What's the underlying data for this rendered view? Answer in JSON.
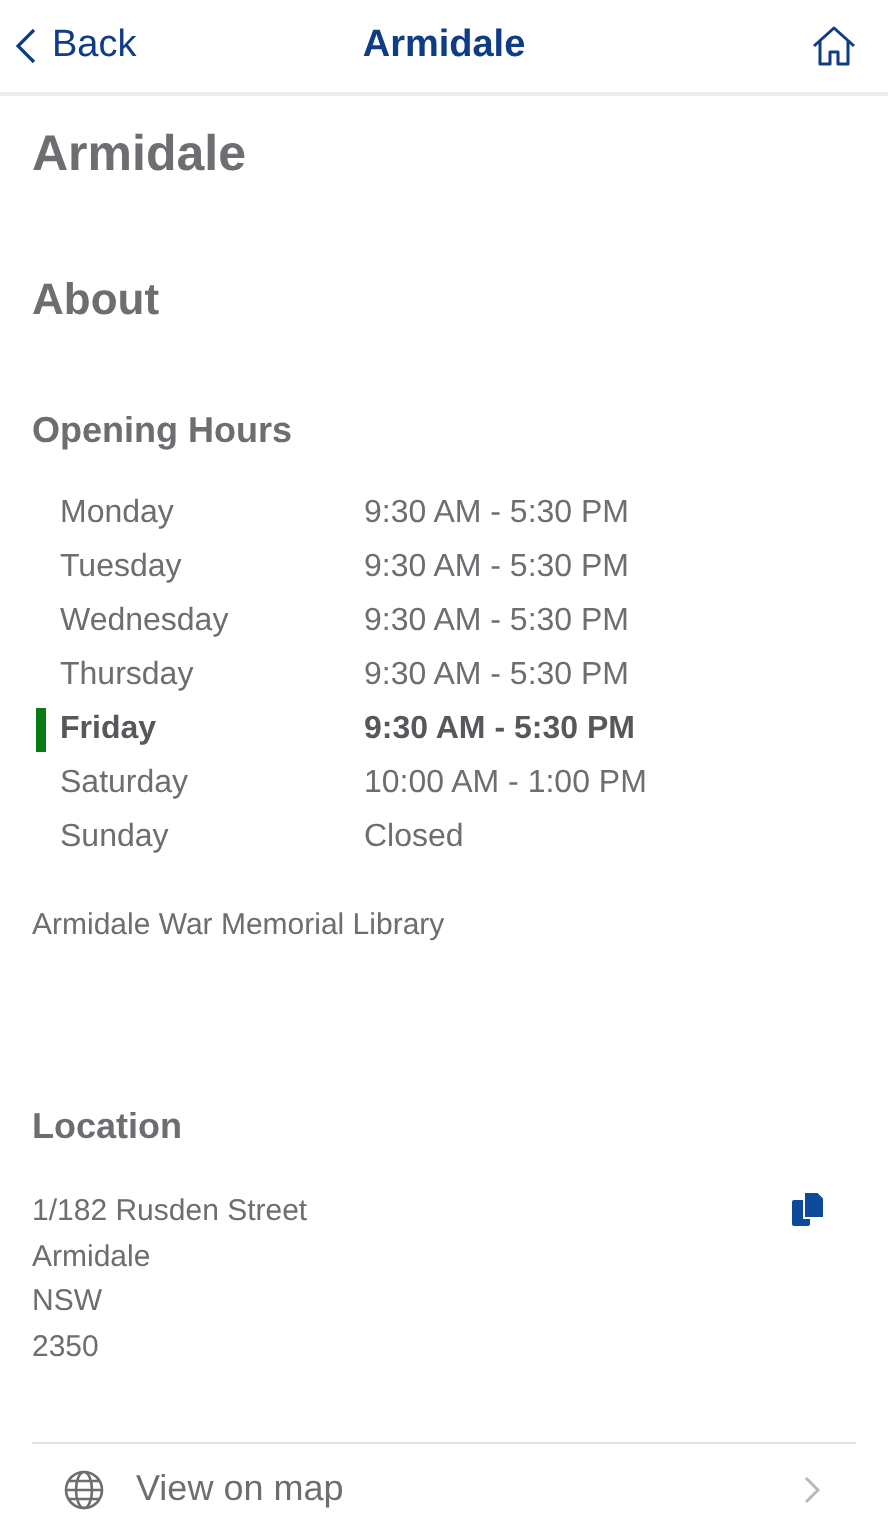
{
  "nav_bar": {
    "back_label": "Back",
    "title": "Armidale"
  },
  "heading": "Armidale",
  "about": {
    "heading": "About"
  },
  "opening_hours": {
    "heading": "Opening Hours",
    "days": [
      {
        "day": "Monday",
        "hours": "9:30 AM - 5:30 PM",
        "today": false
      },
      {
        "day": "Tuesday",
        "hours": "9:30 AM - 5:30 PM",
        "today": false
      },
      {
        "day": "Wednesday",
        "hours": "9:30 AM - 5:30 PM",
        "today": false
      },
      {
        "day": "Thursday",
        "hours": "9:30 AM - 5:30 PM",
        "today": false
      },
      {
        "day": "Friday",
        "hours": "9:30 AM - 5:30 PM",
        "today": true
      },
      {
        "day": "Saturday",
        "hours": "10:00 AM - 1:00 PM",
        "today": false
      },
      {
        "day": "Sunday",
        "hours": "Closed",
        "today": false
      }
    ],
    "branch_name": "Armidale War Memorial Library"
  },
  "location": {
    "heading": "Location",
    "address_lines": [
      "1/182 Rusden Street",
      "Armidale",
      "NSW",
      "2350"
    ],
    "map_link": "View on map"
  }
}
